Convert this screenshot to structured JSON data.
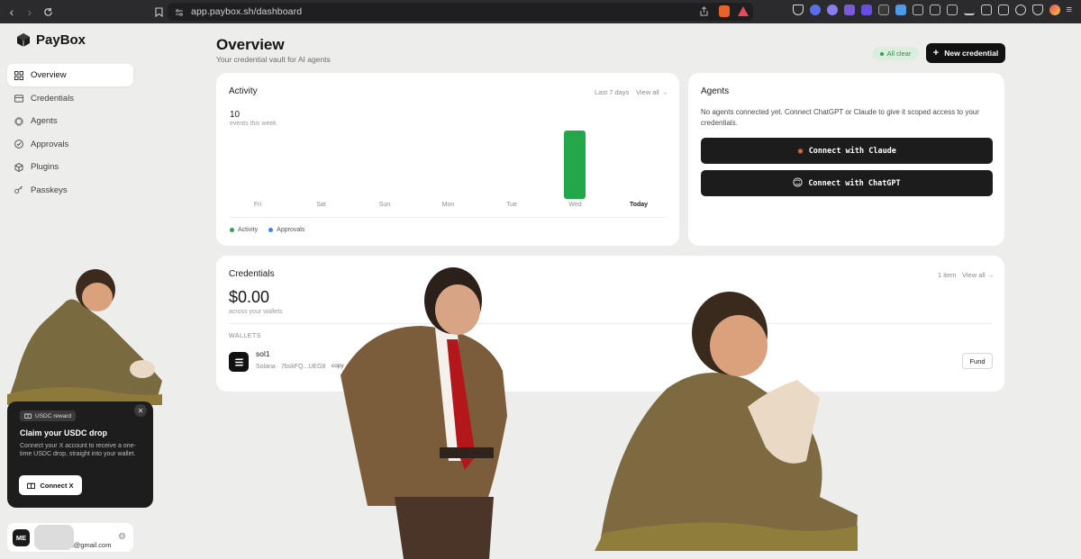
{
  "browser": {
    "url": "app.paybox.sh/dashboard"
  },
  "brand": {
    "name": "PayBox"
  },
  "sidebar": {
    "items": [
      {
        "label": "Overview",
        "icon": "grid-icon",
        "active": true
      },
      {
        "label": "Credentials",
        "icon": "card-icon"
      },
      {
        "label": "Agents",
        "icon": "chip-icon"
      },
      {
        "label": "Approvals",
        "icon": "check-circle-icon"
      },
      {
        "label": "Plugins",
        "icon": "cube-icon"
      },
      {
        "label": "Passkeys",
        "icon": "key-icon"
      }
    ]
  },
  "header": {
    "title": "Overview",
    "subtitle": "Your credential vault for AI agents",
    "status": "All clear",
    "new_button": "New credential"
  },
  "activity": {
    "title": "Activity",
    "range": "Last 7 days",
    "view_all": "View all →",
    "count": "10",
    "count_sub": "events this week",
    "legend": [
      "Activity",
      "Approvals"
    ]
  },
  "chart_data": {
    "type": "bar",
    "categories": [
      "Fri",
      "Sat",
      "Sun",
      "Mon",
      "Tue",
      "Wed",
      "Today"
    ],
    "series": [
      {
        "name": "Activity",
        "values": [
          0,
          0,
          0,
          0,
          0,
          10,
          0
        ],
        "color": "#22a84a"
      },
      {
        "name": "Approvals",
        "values": [
          0,
          0,
          0,
          0,
          0,
          0,
          0
        ],
        "color": "#3b82f6"
      }
    ],
    "ylim": [
      0,
      10
    ]
  },
  "agents": {
    "title": "Agents",
    "description": "No agents connected yet. Connect ChatGPT or Claude to give it scoped access to your credentials.",
    "connect_claude": "Connect with Claude",
    "connect_chatgpt": "Connect with ChatGPT"
  },
  "credentials": {
    "title": "Credentials",
    "count": "1 item",
    "view_all": "View all →",
    "balance": "$0.00",
    "balance_sub": "across your wallets",
    "wallets_heading": "WALLETS",
    "wallet": {
      "name": "sol1",
      "address": "Solana · 7bskFQ...UEG8",
      "copy": "copy",
      "fund": "Fund"
    }
  },
  "reward": {
    "badge": "USDC reward",
    "title": "Claim your USDC drop",
    "text": "Connect your X account to receive a one-time USDC drop, straight into your wallet.",
    "button": "Connect X"
  },
  "user": {
    "initials": "ME",
    "email": "l@gmail.com"
  },
  "colors": {
    "accent_green": "#22a84a",
    "approvals_blue": "#3b82f6",
    "dark": "#111111"
  }
}
